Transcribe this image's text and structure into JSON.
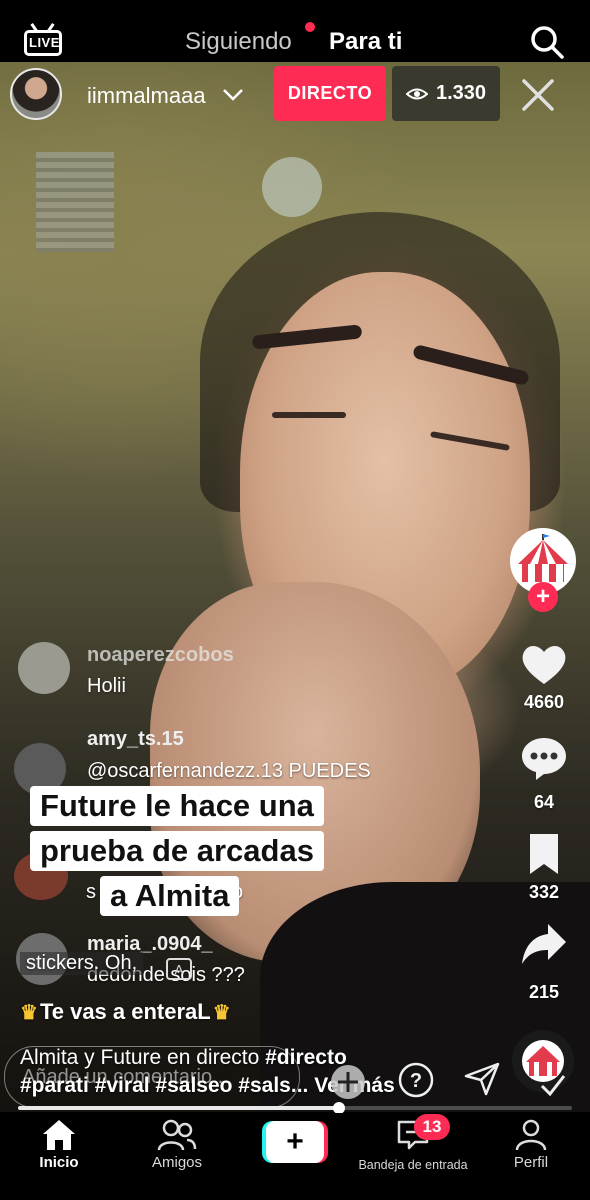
{
  "top": {
    "live_label": "LIVE",
    "tab_following": "Siguiendo",
    "tab_foryou": "Para ti"
  },
  "live_header": {
    "username": "iimmalmaaa",
    "live_badge": "DIRECTO",
    "viewers": "1.330"
  },
  "comments": [
    {
      "user": "noaperezcobos",
      "text": "Holii"
    },
    {
      "user": "amy_ts.15",
      "text": "@oscarfernandezz.13 PUEDES"
    },
    {
      "user": "",
      "text": "s",
      "text2": "zo"
    },
    {
      "user": "maria_.0904_",
      "text": "dedonde sois ???"
    }
  ],
  "caption_overlay": {
    "line1": "Future le hace una",
    "line2": "prueba de arcadas",
    "line3": "a Almita"
  },
  "sticker_text": "stickers. Oh,",
  "gift_line": "Te vas a enteraL",
  "rail": {
    "likes": "4660",
    "comments": "64",
    "saves": "332",
    "shares": "215"
  },
  "description": {
    "text1": "Almita y Future en directo",
    "tag1": "#directo",
    "tags_line2": "#parati #viral #salseo #sals...",
    "more": "Ver más"
  },
  "comment_input": {
    "placeholder": "Añade un comentario..."
  },
  "progress": {
    "played_fraction": 0.58
  },
  "nav": {
    "home": "Inicio",
    "friends": "Amigos",
    "inbox": "Bandeja de entrada",
    "inbox_badge": "13",
    "profile": "Perfil"
  },
  "colors": {
    "accent": "#fe2c55",
    "cyan": "#25f4ee"
  }
}
